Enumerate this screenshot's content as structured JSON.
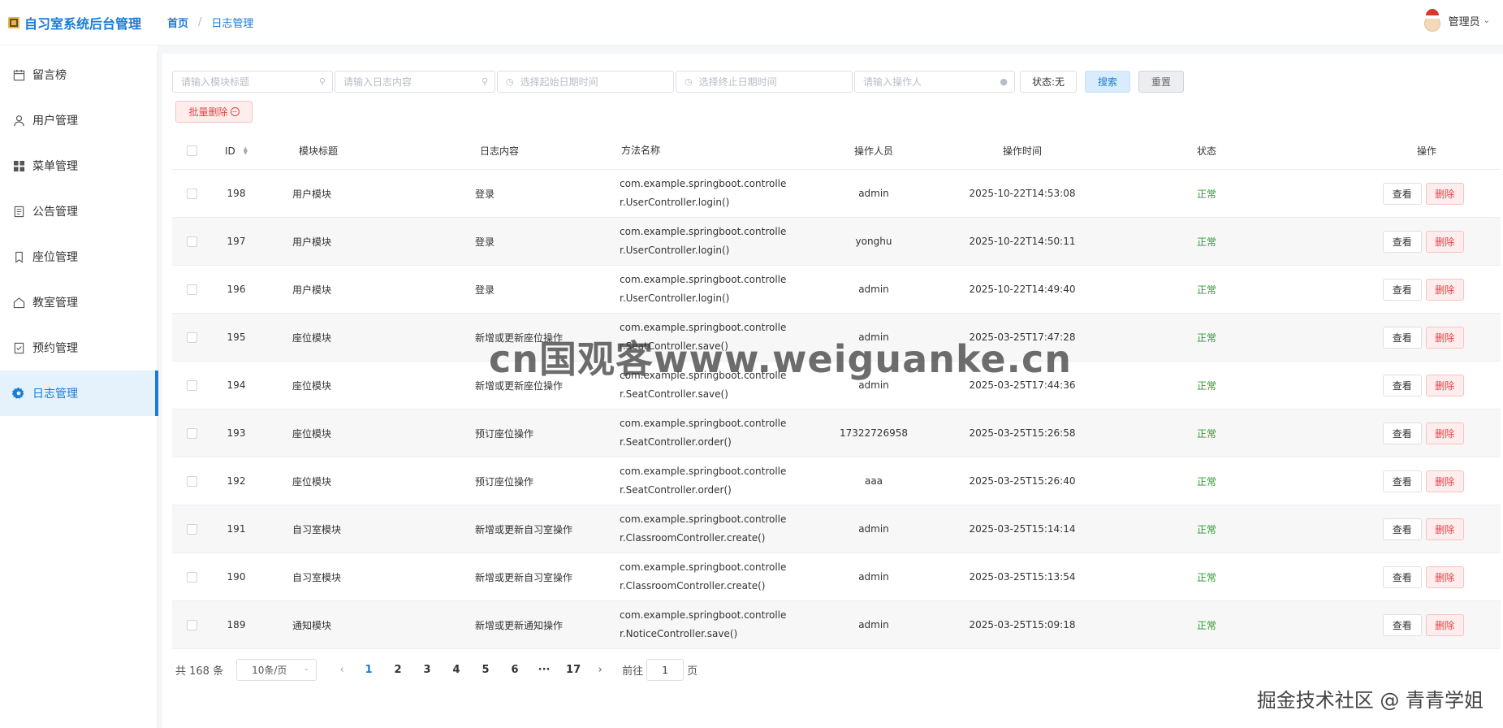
{
  "header": {
    "app_title": "自习室系统后台管理",
    "breadcrumb": [
      "首页",
      "日志管理"
    ],
    "breadcrumb_sep": "/",
    "user_name": "管理员"
  },
  "sidebar": {
    "items": [
      {
        "label": "留言榜",
        "icon": "calendar-icon"
      },
      {
        "label": "用户管理",
        "icon": "user-icon"
      },
      {
        "label": "菜单管理",
        "icon": "grid-icon"
      },
      {
        "label": "公告管理",
        "icon": "document-icon"
      },
      {
        "label": "座位管理",
        "icon": "bookmark-icon"
      },
      {
        "label": "教室管理",
        "icon": "house-icon"
      },
      {
        "label": "预约管理",
        "icon": "checklist-icon"
      },
      {
        "label": "日志管理",
        "icon": "gear-icon",
        "active": true
      }
    ]
  },
  "filters": {
    "module_placeholder": "请输入模块标题",
    "content_placeholder": "请输入日志内容",
    "start_placeholder": "选择起始日期时间",
    "end_placeholder": "选择终止日期时间",
    "operator_placeholder": "请输入操作人",
    "status_label": "状态:无",
    "search_label": "搜索",
    "reset_label": "重置",
    "batch_delete_label": "批量删除"
  },
  "table": {
    "headers": {
      "id": "ID",
      "module": "模块标题",
      "content": "日志内容",
      "method": "方法名称",
      "operator": "操作人员",
      "time": "操作时间",
      "status": "状态",
      "action": "操作"
    },
    "view_label": "查看",
    "delete_label": "删除",
    "rows": [
      {
        "id": "198",
        "module": "用户模块",
        "content": "登录",
        "method1": "com.example.springboot.controlle",
        "method2": "r.UserController.login()",
        "operator": "admin",
        "time": "2025-10-22T14:53:08",
        "status": "正常"
      },
      {
        "id": "197",
        "module": "用户模块",
        "content": "登录",
        "method1": "com.example.springboot.controlle",
        "method2": "r.UserController.login()",
        "operator": "yonghu",
        "time": "2025-10-22T14:50:11",
        "status": "正常"
      },
      {
        "id": "196",
        "module": "用户模块",
        "content": "登录",
        "method1": "com.example.springboot.controlle",
        "method2": "r.UserController.login()",
        "operator": "admin",
        "time": "2025-10-22T14:49:40",
        "status": "正常"
      },
      {
        "id": "195",
        "module": "座位模块",
        "content": "新增或更新座位操作",
        "method1": "com.example.springboot.controlle",
        "method2": "r.SeatController.save()",
        "operator": "admin",
        "time": "2025-03-25T17:47:28",
        "status": "正常"
      },
      {
        "id": "194",
        "module": "座位模块",
        "content": "新增或更新座位操作",
        "method1": "com.example.springboot.controlle",
        "method2": "r.SeatController.save()",
        "operator": "admin",
        "time": "2025-03-25T17:44:36",
        "status": "正常"
      },
      {
        "id": "193",
        "module": "座位模块",
        "content": "预订座位操作",
        "method1": "com.example.springboot.controlle",
        "method2": "r.SeatController.order()",
        "operator": "17322726958",
        "time": "2025-03-25T15:26:58",
        "status": "正常"
      },
      {
        "id": "192",
        "module": "座位模块",
        "content": "预订座位操作",
        "method1": "com.example.springboot.controlle",
        "method2": "r.SeatController.order()",
        "operator": "aaa",
        "time": "2025-03-25T15:26:40",
        "status": "正常"
      },
      {
        "id": "191",
        "module": "自习室模块",
        "content": "新增或更新自习室操作",
        "method1": "com.example.springboot.controlle",
        "method2": "r.ClassroomController.create()",
        "operator": "admin",
        "time": "2025-03-25T15:14:14",
        "status": "正常"
      },
      {
        "id": "190",
        "module": "自习室模块",
        "content": "新增或更新自习室操作",
        "method1": "com.example.springboot.controlle",
        "method2": "r.ClassroomController.create()",
        "operator": "admin",
        "time": "2025-03-25T15:13:54",
        "status": "正常"
      },
      {
        "id": "189",
        "module": "通知模块",
        "content": "新增或更新通知操作",
        "method1": "com.example.springboot.controlle",
        "method2": "r.NoticeController.save()",
        "operator": "admin",
        "time": "2025-03-25T15:09:18",
        "status": "正常"
      }
    ]
  },
  "pagination": {
    "total_text": "共 168 条",
    "page_size": "10条/页",
    "pages": [
      "1",
      "2",
      "3",
      "4",
      "5",
      "6",
      "···",
      "17"
    ],
    "current_page": "1",
    "goto_prefix": "前往",
    "goto_value": "1",
    "goto_suffix": "页"
  },
  "watermarks": {
    "site": "cn国观客www.weiguanke.cn",
    "juejin": "掘金技术社区 @ 青青学姐"
  },
  "colors": {
    "accent": "#1a7bd6",
    "danger": "#e04545",
    "success": "#2c9b2e"
  }
}
